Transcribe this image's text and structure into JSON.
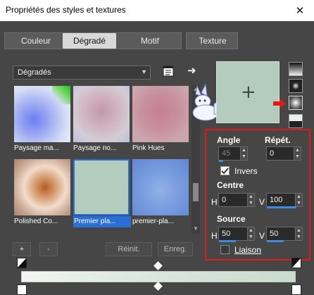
{
  "window": {
    "title": "Propriétés des styles et textures",
    "close_glyph": "✕"
  },
  "tabs": [
    {
      "label": "Couleur",
      "active": false
    },
    {
      "label": "Dégradé",
      "active": true
    },
    {
      "label": "Motif",
      "active": false
    },
    {
      "label": "Texture",
      "active": false
    }
  ],
  "library": {
    "dropdown_label": "Dégradés",
    "dropdown_arrow": "▼",
    "right_arrow_glyph": "➜",
    "items": [
      {
        "label": "Paysage ma...",
        "selected": false
      },
      {
        "label": "Paysage no...",
        "selected": false
      },
      {
        "label": "Pink Hues",
        "selected": false
      },
      {
        "label": "Polished Co...",
        "selected": false
      },
      {
        "label": "Premier pla...",
        "selected": true
      },
      {
        "label": "premier-pla...",
        "selected": false
      }
    ]
  },
  "preview": {
    "crosshair": "+",
    "color": "#b3ccbd"
  },
  "settings": {
    "angle_label": "Angle",
    "angle_value": "45",
    "repeat_label": "Répét.",
    "repeat_value": "0",
    "invert_label": "Invers",
    "invert_checked": true,
    "center_label": "Centre",
    "center_h_label": "H",
    "center_h_value": "0",
    "center_v_label": "V",
    "center_v_value": "100",
    "source_label": "Source",
    "source_h_label": "H",
    "source_h_value": "50",
    "source_v_label": "V",
    "source_v_value": "50",
    "link_label": "Liaison",
    "link_checked": false
  },
  "bottom_buttons": {
    "add": "+",
    "remove": "-",
    "reset": "Réinit.",
    "save": "Enreg."
  },
  "colors": {
    "accent_blue": "#2a6fd6",
    "highlight_red": "#e01a1a",
    "dialog_bg": "#464646"
  }
}
